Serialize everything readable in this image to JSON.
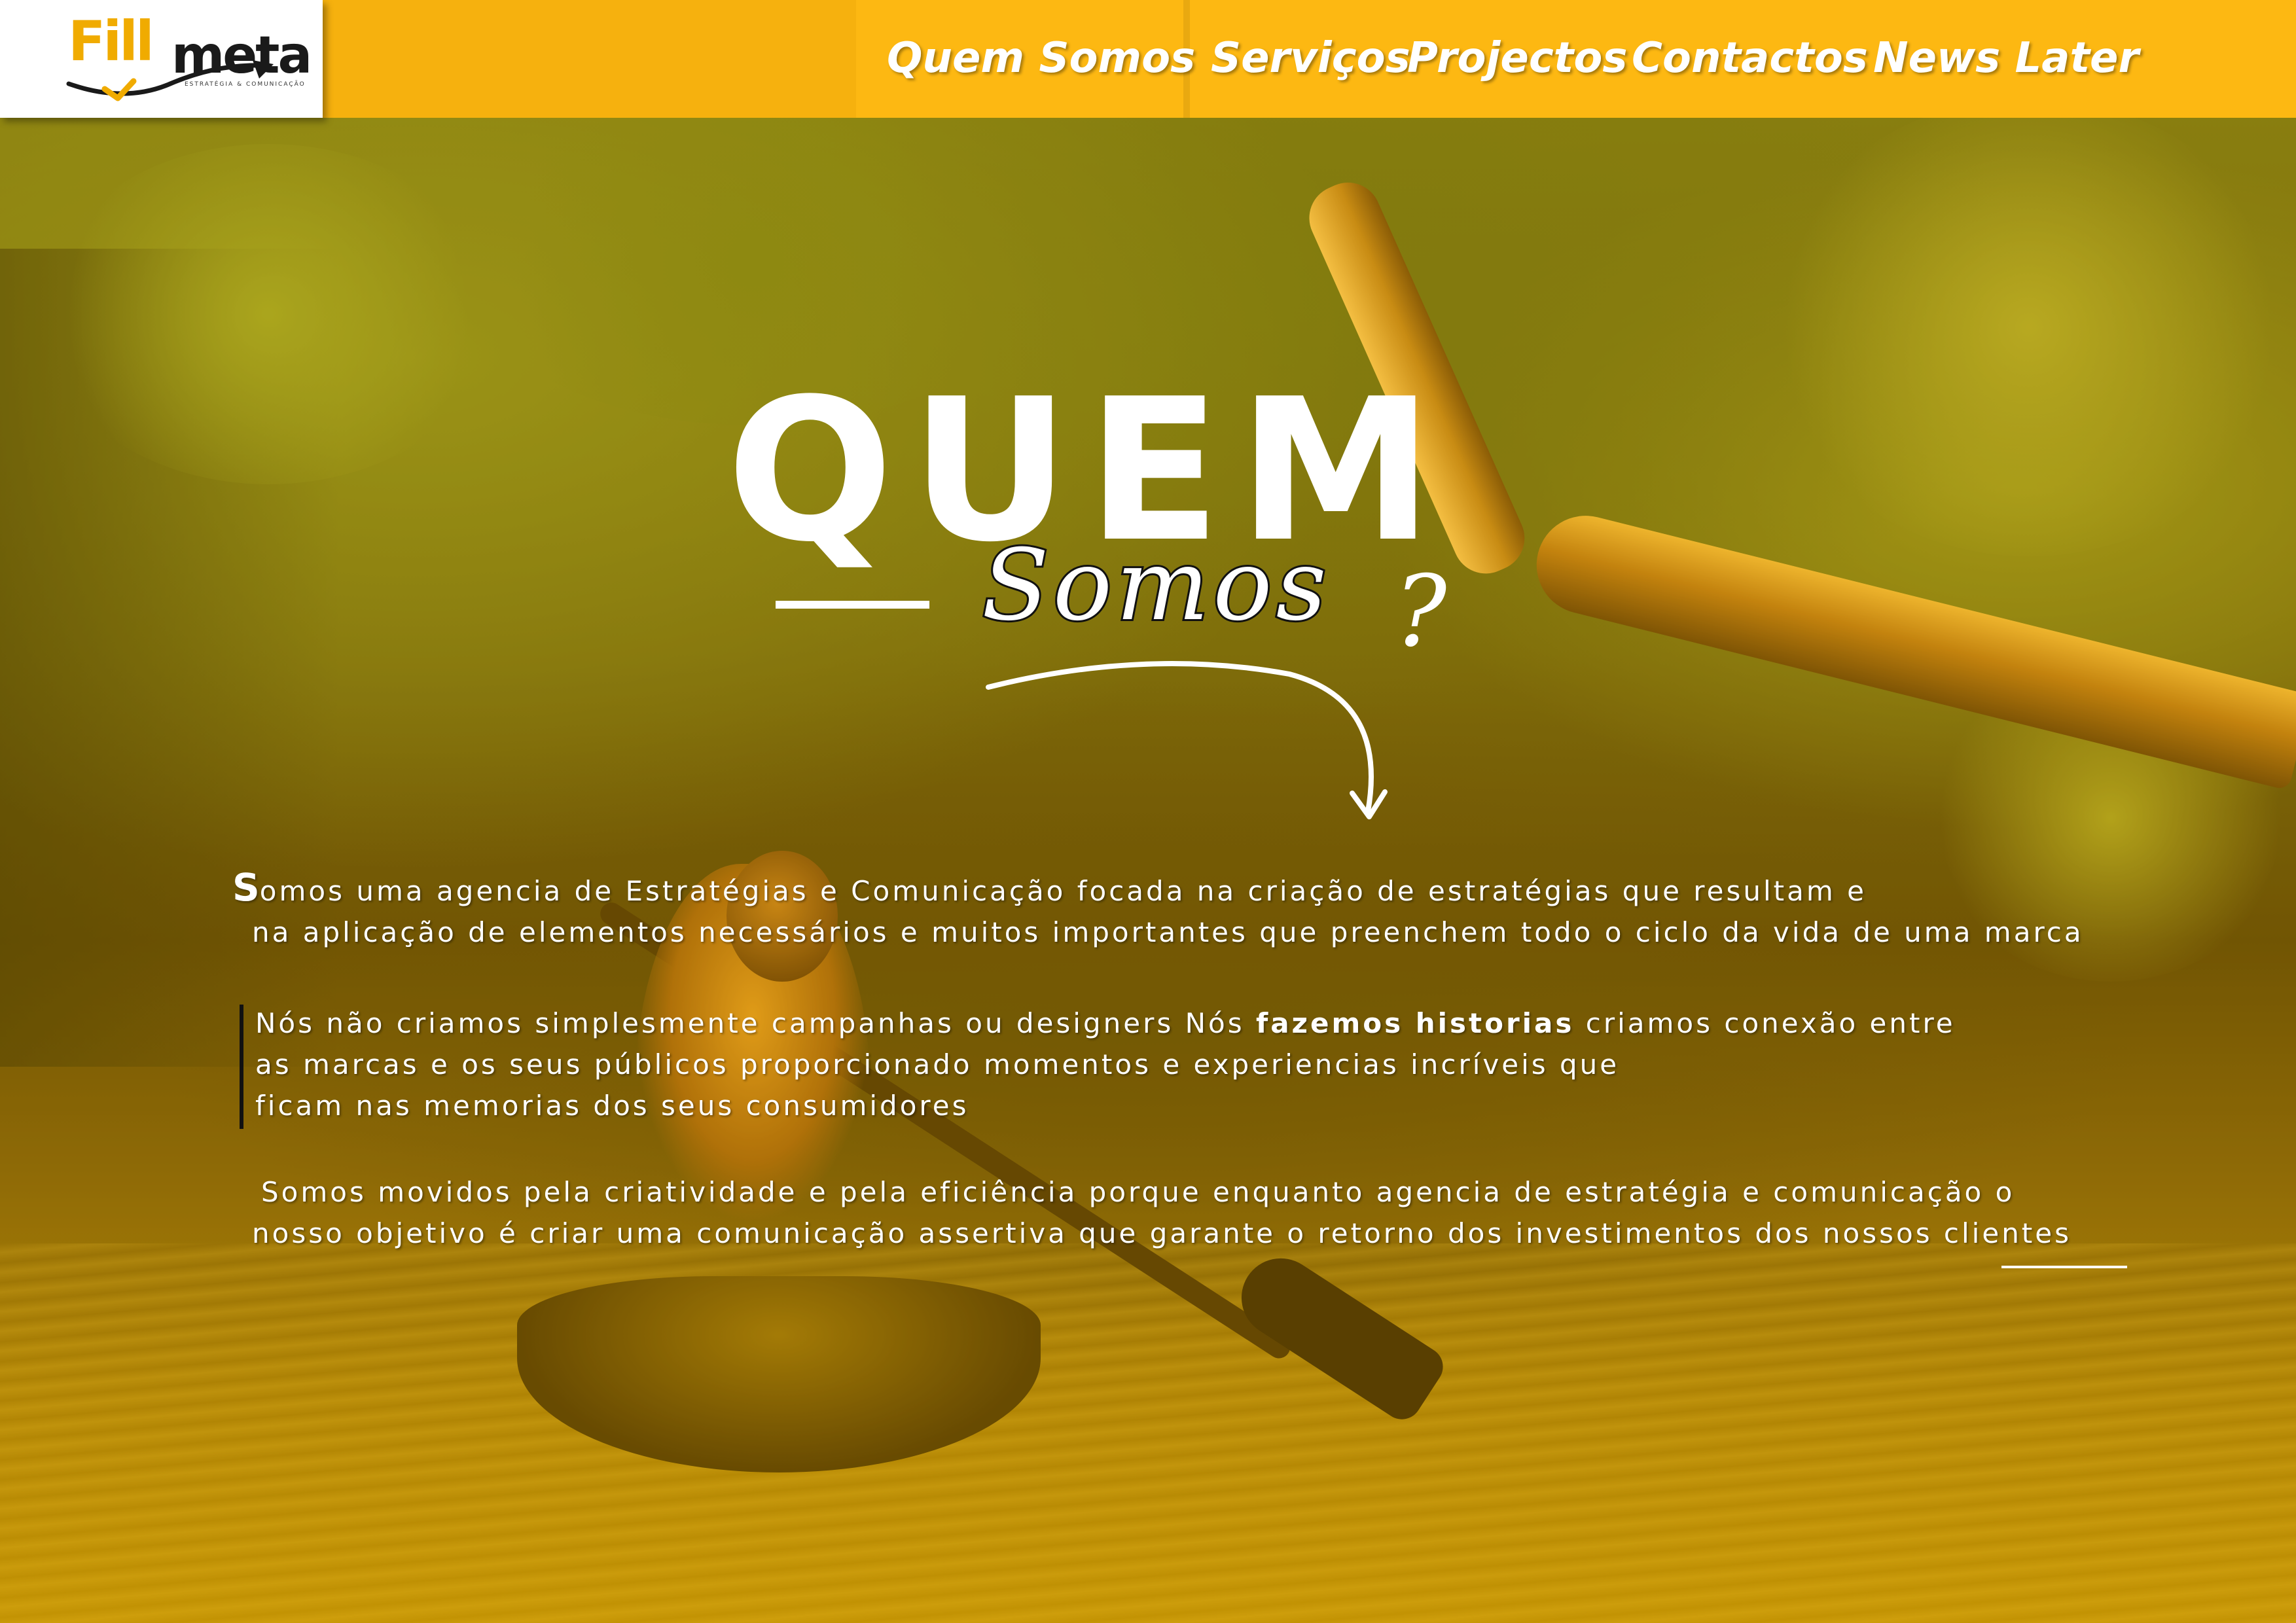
{
  "brand": {
    "logo_fill": "Fill",
    "logo_meta": "meta",
    "logo_tagline": "ESTRATÉGIA & COMUNICAÇÃO",
    "accent_color": "#fdb812",
    "dark_color": "#1a1a1a"
  },
  "nav": {
    "items": [
      {
        "label": "Quem Somos"
      },
      {
        "label": "Serviços"
      },
      {
        "label": "Projectos"
      },
      {
        "label": "Contactos"
      },
      {
        "label": "News Later"
      }
    ]
  },
  "hero": {
    "title": "QUEM",
    "subtitle": "Somos",
    "question_mark": "?"
  },
  "content": {
    "p1": {
      "dropcap": "S",
      "line1_rest": "omos uma agencia de Estratégias e Comunicação focada na criação de estratégias que resultam e",
      "line2": "na aplicação de elementos necessários e muitos importantes que preenchem todo o ciclo da vida de uma marca"
    },
    "p2": {
      "line1_a": "Nós não criamos simplesmente campanhas ou designers  Nós ",
      "line1_bold": "fazemos historias",
      "line1_b": "  criamos conexão entre",
      "line2": "as marcas e os seus públicos proporcionado momentos e experiencias incríveis que",
      "line3": "ficam nas memorias dos seus consumidores"
    },
    "p3": {
      "line1": "Somos movidos pela criatividade e pela eficiência  porque enquanto agencia de estratégia e comunicação o",
      "line2": "nosso objetivo é criar uma comunicação assertiva que garante o retorno dos investimentos dos nossos clientes"
    }
  }
}
